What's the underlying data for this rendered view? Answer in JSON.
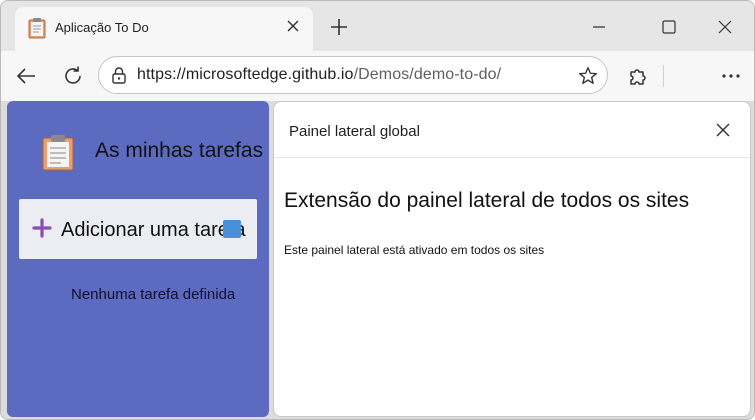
{
  "tab": {
    "title": "Aplicação To Do",
    "favicon": "clipboard-icon"
  },
  "address": {
    "url_host": "https://microsoftedge.github.io",
    "url_path": "/Demos/demo-to-do/"
  },
  "app": {
    "title": "As minhas tarefas",
    "add_task_label": "Adicionar uma tarefa",
    "empty_message": "Nenhuma tarefa definida",
    "background_color": "#5c6bc0"
  },
  "side_panel": {
    "header_title": "Painel lateral global",
    "heading": "Extensão do painel lateral de todos os sites",
    "body_text": "Este painel lateral está ativado em todos os sites"
  }
}
